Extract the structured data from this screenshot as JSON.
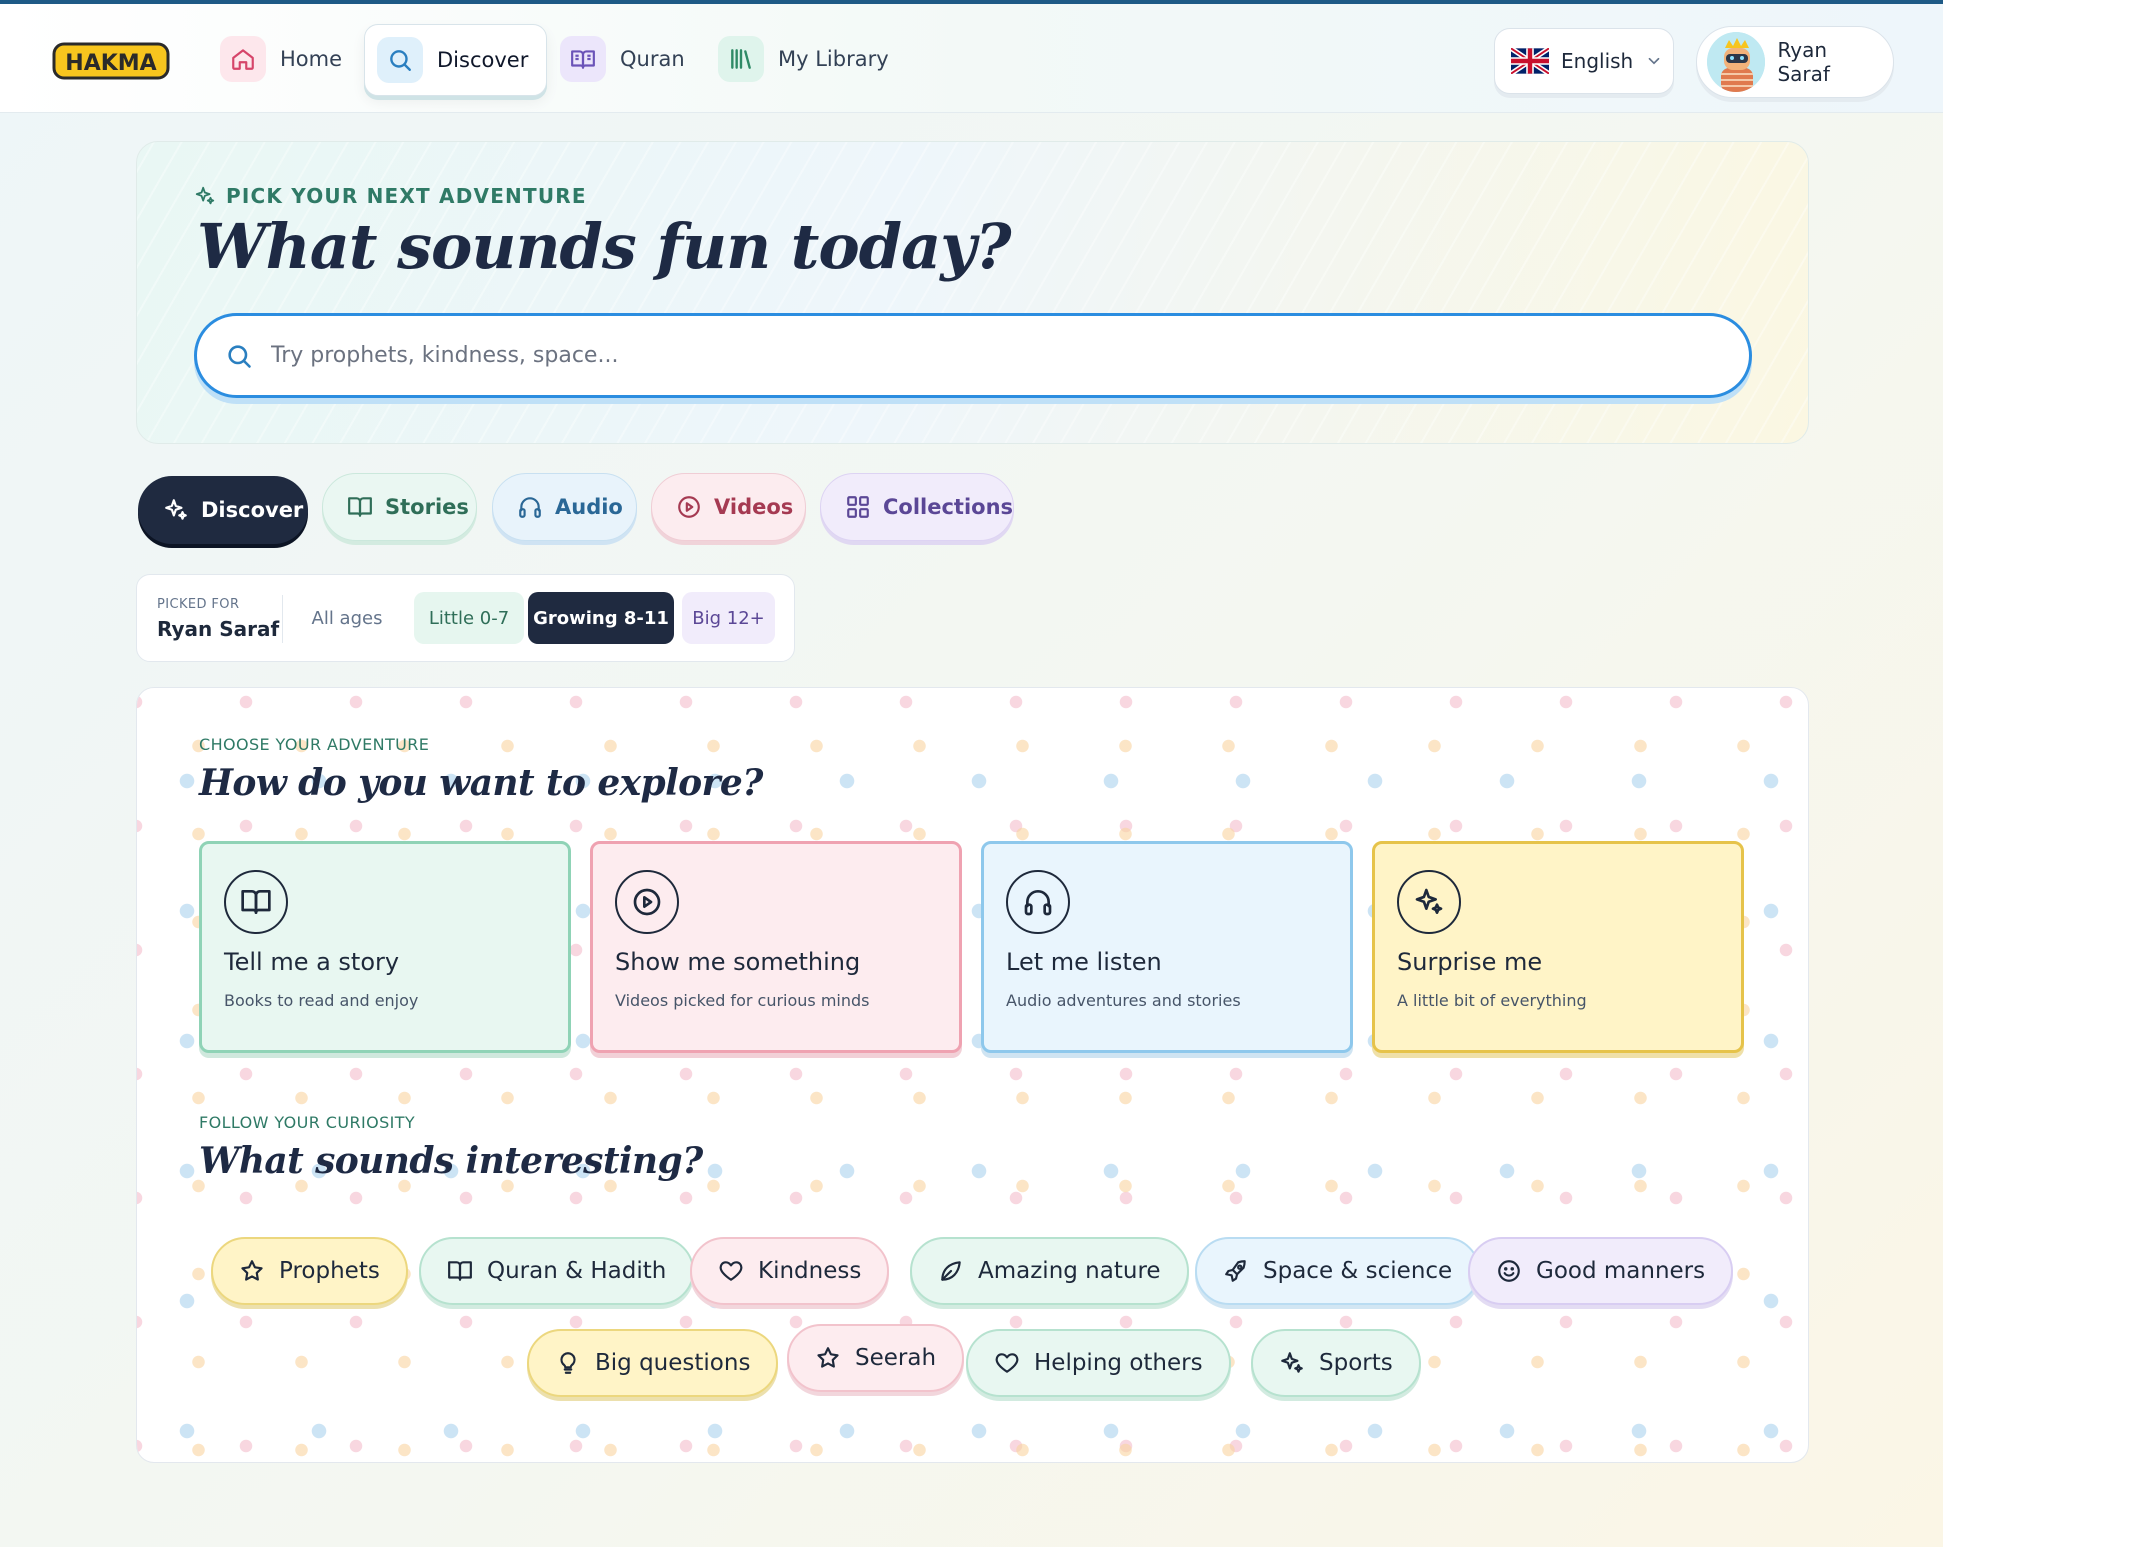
{
  "app": {
    "logo_text": "HAKMA"
  },
  "nav": {
    "home": "Home",
    "discover": "Discover",
    "quran": "Quran",
    "library": "My Library",
    "language": "English",
    "user_name": "Ryan Saraf"
  },
  "hero": {
    "eyebrow": "PICK YOUR NEXT ADVENTURE",
    "title": "What sounds fun today?",
    "search_placeholder": "Try prophets, kindness, space..."
  },
  "tabs": {
    "discover": "Discover",
    "stories": "Stories",
    "audio": "Audio",
    "videos": "Videos",
    "collections": "Collections"
  },
  "age_filter": {
    "picked_label": "PICKED FOR",
    "picked_name": "Ryan Saraf",
    "all": "All ages",
    "little": "Little 0-7",
    "growing": "Growing 8-11",
    "big": "Big 12+",
    "selected": "Growing 8-11"
  },
  "explore": {
    "label": "CHOOSE YOUR ADVENTURE",
    "title": "How do you want to explore?",
    "cards": [
      {
        "title": "Tell me a story",
        "subtitle": "Books to read and enjoy",
        "icon": "book-icon"
      },
      {
        "title": "Show me something",
        "subtitle": "Videos picked for curious minds",
        "icon": "play-circle-icon"
      },
      {
        "title": "Let me listen",
        "subtitle": "Audio adventures and stories",
        "icon": "headphones-icon"
      },
      {
        "title": "Surprise me",
        "subtitle": "A little bit of everything",
        "icon": "sparkles-icon"
      }
    ]
  },
  "curiosity": {
    "label": "FOLLOW YOUR CURIOSITY",
    "title": "What sounds interesting?",
    "topics": [
      {
        "label": "Prophets",
        "icon": "star-icon"
      },
      {
        "label": "Quran & Hadith",
        "icon": "book-icon"
      },
      {
        "label": "Kindness",
        "icon": "heart-icon"
      },
      {
        "label": "Amazing nature",
        "icon": "leaf-icon"
      },
      {
        "label": "Space & science",
        "icon": "rocket-icon"
      },
      {
        "label": "Good manners",
        "icon": "smile-icon"
      },
      {
        "label": "Big questions",
        "icon": "lightbulb-icon"
      },
      {
        "label": "Seerah",
        "icon": "star-icon"
      },
      {
        "label": "Helping others",
        "icon": "heart-icon"
      },
      {
        "label": "Sports",
        "icon": "sparkles-icon"
      }
    ]
  },
  "colors": {
    "accent_dark": "#1f2a40",
    "search_border": "#2b8de0",
    "logo_yellow": "#f7c51e"
  }
}
